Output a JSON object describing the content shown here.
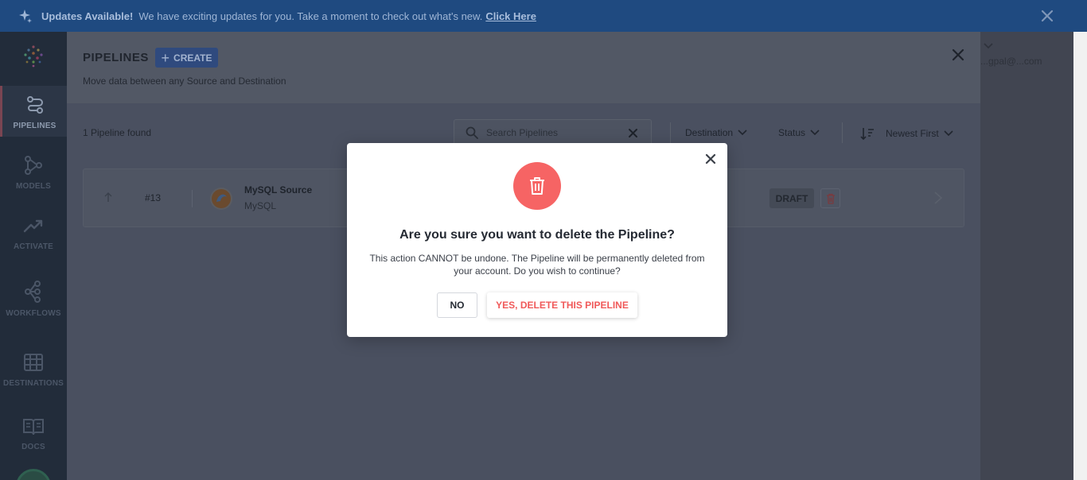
{
  "banner": {
    "icon": "sparkle-icon",
    "title": "Updates Available!",
    "message": "We have exciting updates for you. Take a moment to check out what's new.",
    "link": "Click Here"
  },
  "sidebar": {
    "items": [
      {
        "label": "PIPELINES",
        "icon": "pipelines-icon",
        "active": true
      },
      {
        "label": "MODELS",
        "icon": "models-icon",
        "active": false
      },
      {
        "label": "ACTIVATE",
        "icon": "trend-up-icon",
        "active": false
      },
      {
        "label": "WORKFLOWS",
        "icon": "workflows-icon",
        "active": false
      },
      {
        "label": "DESTINATIONS",
        "icon": "destinations-icon",
        "active": false
      },
      {
        "label": "DOCS",
        "icon": "book-icon",
        "active": false
      }
    ]
  },
  "header": {
    "title": "PIPELINES",
    "create_label": "CREATE",
    "subtitle": "Move data between any Source and Destination"
  },
  "toolbar": {
    "count": "1 Pipeline found",
    "search_placeholder": "Search Pipelines",
    "destination_filter": "Destination",
    "status_filter": "Status",
    "sort": "Newest First"
  },
  "pipelines": [
    {
      "id": "#13",
      "source_name": "MySQL Source",
      "source_type": "MySQL",
      "status": "DRAFT"
    }
  ],
  "user": {
    "email": "...gpal@...com"
  },
  "modal": {
    "title": "Are you sure you want to delete the Pipeline?",
    "body": "This action CANNOT be undone. The Pipeline will be permanently deleted from your account. Do you wish to continue?",
    "no_label": "NO",
    "yes_label": "YES, DELETE THIS PIPELINE"
  },
  "colors": {
    "banner_bg": "#1f4a80",
    "sidebar_bg": "#222c3a",
    "danger": "#f66464",
    "primary": "#2f4a7e"
  }
}
